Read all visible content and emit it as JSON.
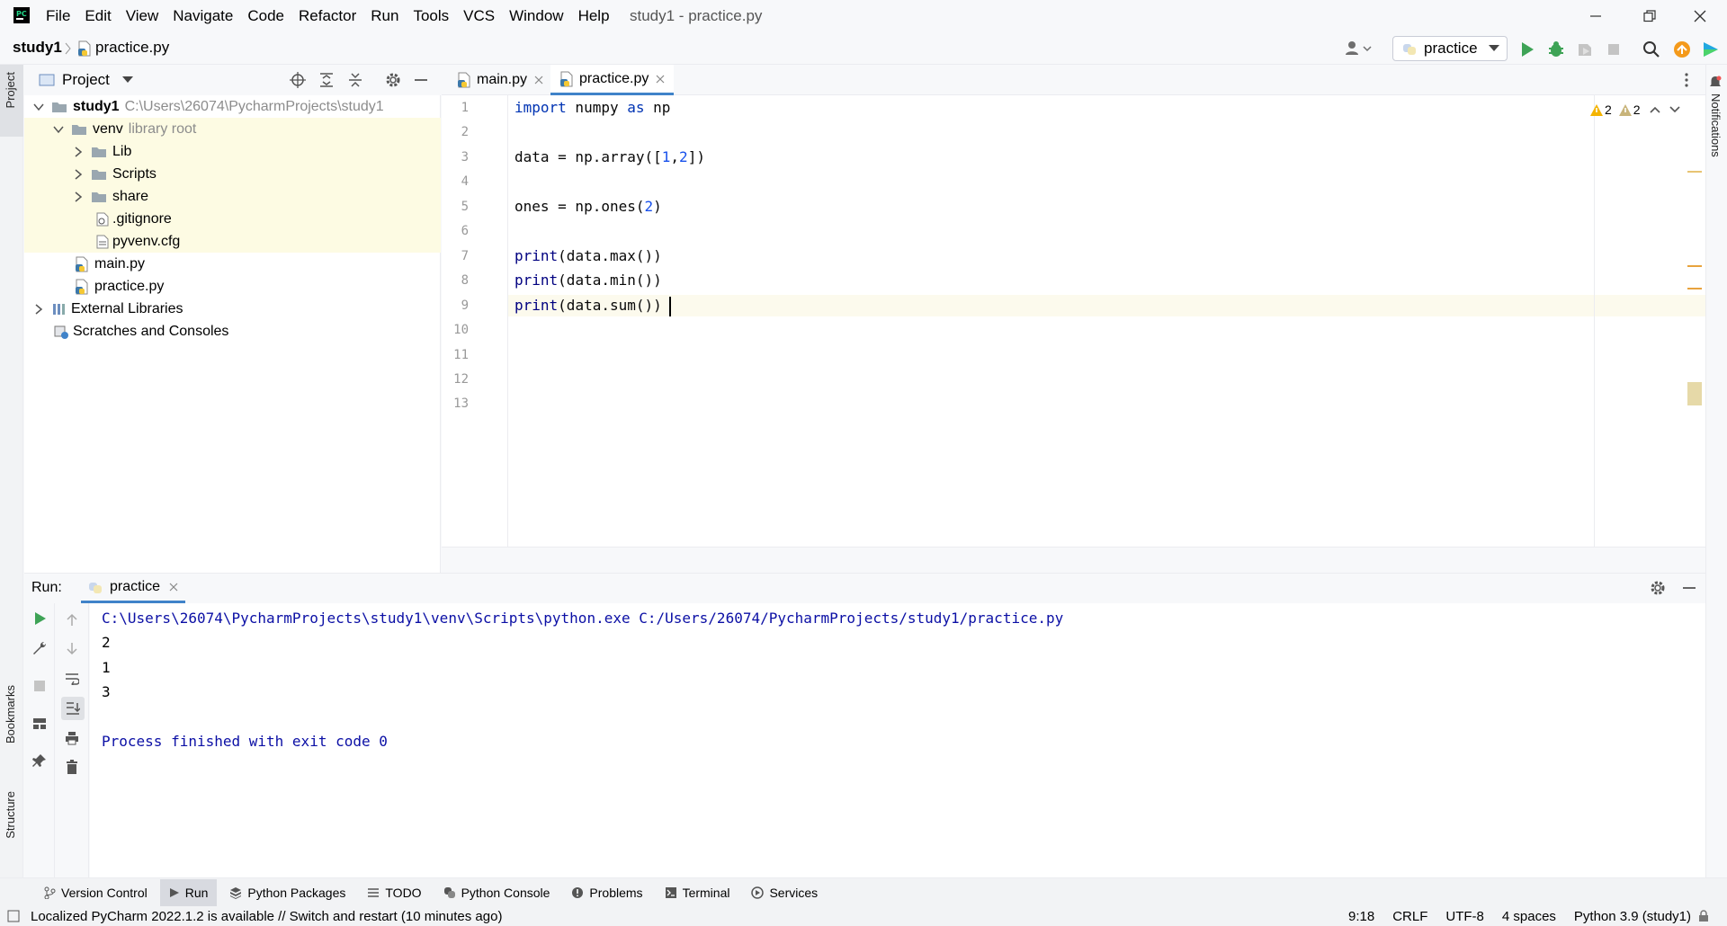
{
  "menu": [
    "File",
    "Edit",
    "View",
    "Navigate",
    "Code",
    "Refactor",
    "Run",
    "Tools",
    "VCS",
    "Window",
    "Help"
  ],
  "window_title": "study1 - practice.py",
  "breadcrumb": {
    "project": "study1",
    "file": "practice.py"
  },
  "run_config": "practice",
  "project_panel": {
    "title": "Project",
    "tree": [
      {
        "label": "study1",
        "extra": "C:\\Users\\26074\\PycharmProjects\\study1"
      },
      {
        "label": "venv",
        "extra": "library root"
      },
      {
        "label": "Lib"
      },
      {
        "label": "Scripts"
      },
      {
        "label": "share"
      },
      {
        "label": ".gitignore"
      },
      {
        "label": "pyvenv.cfg"
      },
      {
        "label": "main.py"
      },
      {
        "label": "practice.py"
      },
      {
        "label": "External Libraries"
      },
      {
        "label": "Scratches and Consoles"
      }
    ]
  },
  "editor": {
    "tabs": [
      "main.py",
      "practice.py"
    ],
    "active_tab": "practice.py",
    "line_numbers": [
      "1",
      "2",
      "3",
      "4",
      "5",
      "6",
      "7",
      "8",
      "9",
      "10",
      "11",
      "12",
      "13"
    ],
    "code": {
      "l1": {
        "kw1": "import",
        "t1": " numpy ",
        "kw2": "as",
        "t2": " np"
      },
      "l3": {
        "t1": "data = np.array([",
        "n1": "1",
        "t2": ",",
        "n2": "2",
        "t3": "])"
      },
      "l5": {
        "t1": "ones = np.ones(",
        "n1": "2",
        "t2": ")"
      },
      "l7": {
        "fn": "print",
        "rest": "(data.max())"
      },
      "l8": {
        "fn": "print",
        "rest": "(data.min())"
      },
      "l9": {
        "fn": "print",
        "rest": "(data.sum())"
      }
    },
    "warnings": {
      "count1": "2",
      "count2": "2"
    }
  },
  "run": {
    "label": "Run:",
    "tab": "practice",
    "console": [
      "C:\\Users\\26074\\PycharmProjects\\study1\\venv\\Scripts\\python.exe C:/Users/26074/PycharmProjects/study1/practice.py",
      "2",
      "1",
      "3",
      "",
      "Process finished with exit code 0"
    ]
  },
  "side_labels": {
    "project": "Project",
    "bookmarks": "Bookmarks",
    "structure": "Structure",
    "notifications": "Notifications"
  },
  "bottom_tools": [
    "Version Control",
    "Run",
    "Python Packages",
    "TODO",
    "Python Console",
    "Problems",
    "Terminal",
    "Services"
  ],
  "status": {
    "message": "Localized PyCharm 2022.1.2 is available // Switch and restart (10 minutes ago)",
    "position": "9:18",
    "line_sep": "CRLF",
    "encoding": "UTF-8",
    "indent": "4 spaces",
    "interpreter": "Python 3.9 (study1)"
  },
  "colors": {
    "accent": "#4083c9",
    "run_green": "#3ea356",
    "warning": "#e8a33d",
    "keyword": "#0033b3",
    "number": "#1750eb"
  }
}
